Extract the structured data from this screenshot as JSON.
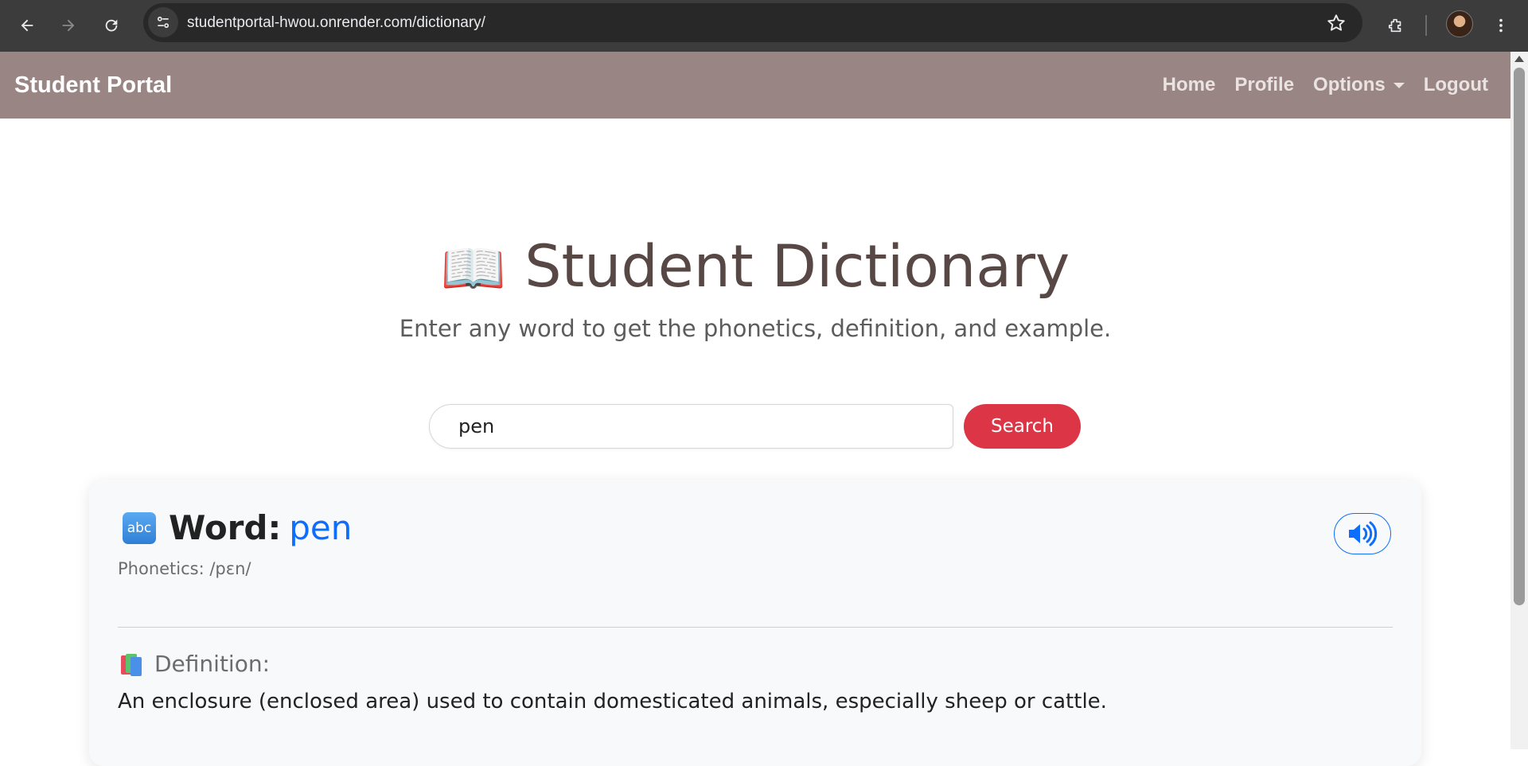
{
  "browser": {
    "url": "studentportal-hwou.onrender.com/dictionary/",
    "icons": [
      "back-icon",
      "forward-icon",
      "reload-icon",
      "site-info-icon",
      "star-icon",
      "extensions-icon",
      "profile-avatar",
      "menu-icon"
    ]
  },
  "navbar": {
    "brand": "Student Portal",
    "links": {
      "home": "Home",
      "profile": "Profile",
      "options": "Options",
      "logout": "Logout"
    },
    "background": "#998684"
  },
  "hero": {
    "title": "Student Dictionary",
    "subtitle": "Enter any word to get the phonetics, definition, and example."
  },
  "search": {
    "value": "pen",
    "button_label": "Search",
    "button_color": "#dc3545"
  },
  "result": {
    "word_label": "Word:",
    "word": "pen",
    "phonetics": "Phonetics: /pɛn/",
    "definition_heading": "Definition:",
    "definition": "An enclosure (enclosed area) used to contain domesticated animals, especially sheep or cattle.",
    "accent": "#0d6efd",
    "abc_icon_text": "abc"
  }
}
